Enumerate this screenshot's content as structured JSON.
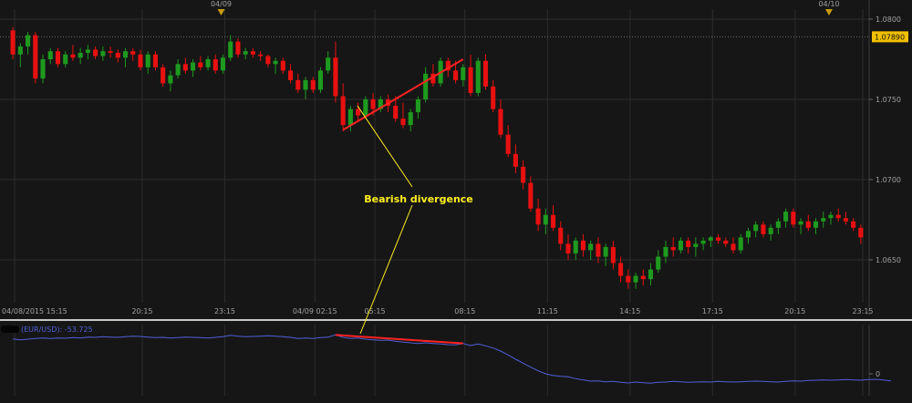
{
  "chart_data": [
    {
      "type": "candlestick",
      "symbol": "EUR/USD",
      "y_axis": {
        "ticks": [
          "1.0800",
          "1.0750",
          "1.0700",
          "1.0650"
        ],
        "range": [
          1.0615,
          1.0815
        ]
      },
      "x_axis": {
        "ticks": [
          "04/08/2015 15:15",
          "20:15",
          "23:15",
          "04/09 02:15",
          "05:15",
          "08:15",
          "11:15",
          "14:15",
          "17:15",
          "20:15",
          "23:15"
        ]
      },
      "date_markers": [
        "04/09",
        "04/10"
      ],
      "current_price": {
        "label": "1.07890",
        "value": 1.0789
      },
      "candles": [
        [
          1.0793,
          1.0795,
          1.0775,
          1.0778
        ],
        [
          1.0778,
          1.0785,
          1.077,
          1.0783
        ],
        [
          1.0783,
          1.0792,
          1.0778,
          1.079
        ],
        [
          1.079,
          1.0792,
          1.076,
          1.0763
        ],
        [
          1.0763,
          1.0778,
          1.076,
          1.0775
        ],
        [
          1.0775,
          1.0782,
          1.0772,
          1.078
        ],
        [
          1.078,
          1.0782,
          1.077,
          1.0772
        ],
        [
          1.0772,
          1.078,
          1.077,
          1.0778
        ],
        [
          1.0778,
          1.0784,
          1.0774,
          1.0776
        ],
        [
          1.0776,
          1.0782,
          1.0772,
          1.0779
        ],
        [
          1.0779,
          1.0784,
          1.0775,
          1.0781
        ],
        [
          1.0781,
          1.0783,
          1.0775,
          1.0777
        ],
        [
          1.0777,
          1.0783,
          1.0774,
          1.078
        ],
        [
          1.078,
          1.0783,
          1.0776,
          1.0779
        ],
        [
          1.0779,
          1.0781,
          1.0773,
          1.0776
        ],
        [
          1.0776,
          1.0782,
          1.077,
          1.078
        ],
        [
          1.078,
          1.0782,
          1.0774,
          1.0778
        ],
        [
          1.0778,
          1.0781,
          1.0768,
          1.077
        ],
        [
          1.077,
          1.078,
          1.0766,
          1.0778
        ],
        [
          1.0778,
          1.078,
          1.0768,
          1.077
        ],
        [
          1.077,
          1.0772,
          1.0758,
          1.076
        ],
        [
          1.076,
          1.0768,
          1.0755,
          1.0765
        ],
        [
          1.0765,
          1.0775,
          1.0763,
          1.0772
        ],
        [
          1.0772,
          1.0776,
          1.0766,
          1.0768
        ],
        [
          1.0768,
          1.0775,
          1.0764,
          1.0773
        ],
        [
          1.0773,
          1.0777,
          1.0768,
          1.077
        ],
        [
          1.077,
          1.0777,
          1.0768,
          1.0775
        ],
        [
          1.0775,
          1.0778,
          1.0766,
          1.0768
        ],
        [
          1.0768,
          1.0778,
          1.0766,
          1.0776
        ],
        [
          1.0776,
          1.079,
          1.0774,
          1.0786
        ],
        [
          1.0786,
          1.0788,
          1.0776,
          1.0778
        ],
        [
          1.0778,
          1.0782,
          1.0775,
          1.078
        ],
        [
          1.078,
          1.0782,
          1.0776,
          1.0778
        ],
        [
          1.0778,
          1.078,
          1.0774,
          1.0777
        ],
        [
          1.0777,
          1.0778,
          1.077,
          1.0772
        ],
        [
          1.0772,
          1.0776,
          1.0766,
          1.0774
        ],
        [
          1.0774,
          1.0776,
          1.0766,
          1.0768
        ],
        [
          1.0768,
          1.0772,
          1.076,
          1.0762
        ],
        [
          1.0762,
          1.0766,
          1.0754,
          1.0756
        ],
        [
          1.0756,
          1.0764,
          1.075,
          1.0762
        ],
        [
          1.0762,
          1.0764,
          1.0754,
          1.0756
        ],
        [
          1.0756,
          1.077,
          1.0754,
          1.0768
        ],
        [
          1.0768,
          1.078,
          1.0766,
          1.0776
        ],
        [
          1.0776,
          1.0786,
          1.0748,
          1.0752
        ],
        [
          1.0752,
          1.076,
          1.073,
          1.0734
        ],
        [
          1.0734,
          1.0746,
          1.073,
          1.0744
        ],
        [
          1.0744,
          1.0748,
          1.0736,
          1.074
        ],
        [
          1.074,
          1.0752,
          1.0738,
          1.075
        ],
        [
          1.075,
          1.0754,
          1.074,
          1.0744
        ],
        [
          1.0744,
          1.0752,
          1.0742,
          1.075
        ],
        [
          1.075,
          1.0753,
          1.0742,
          1.0746
        ],
        [
          1.0746,
          1.0752,
          1.0736,
          1.0738
        ],
        [
          1.0738,
          1.0748,
          1.0732,
          1.0734
        ],
        [
          1.0734,
          1.0744,
          1.073,
          1.0742
        ],
        [
          1.0742,
          1.0752,
          1.0738,
          1.075
        ],
        [
          1.075,
          1.077,
          1.0748,
          1.0766
        ],
        [
          1.0766,
          1.0772,
          1.0758,
          1.076
        ],
        [
          1.076,
          1.0776,
          1.0758,
          1.0774
        ],
        [
          1.0774,
          1.0776,
          1.0764,
          1.0768
        ],
        [
          1.0768,
          1.0774,
          1.076,
          1.0762
        ],
        [
          1.0762,
          1.0772,
          1.0758,
          1.077
        ],
        [
          1.077,
          1.0778,
          1.0752,
          1.0754
        ],
        [
          1.0754,
          1.0776,
          1.0752,
          1.0774
        ],
        [
          1.0774,
          1.0778,
          1.0756,
          1.0758
        ],
        [
          1.0758,
          1.0762,
          1.0742,
          1.0744
        ],
        [
          1.0744,
          1.075,
          1.0726,
          1.0728
        ],
        [
          1.0728,
          1.0734,
          1.0714,
          1.0716
        ],
        [
          1.0716,
          1.0722,
          1.0704,
          1.0708
        ],
        [
          1.0708,
          1.0712,
          1.0694,
          1.0698
        ],
        [
          1.0698,
          1.0702,
          1.068,
          1.0682
        ],
        [
          1.0682,
          1.0688,
          1.0668,
          1.0672
        ],
        [
          1.0672,
          1.0682,
          1.0666,
          1.0678
        ],
        [
          1.0678,
          1.0684,
          1.0668,
          1.067
        ],
        [
          1.067,
          1.0674,
          1.0656,
          1.066
        ],
        [
          1.066,
          1.0666,
          1.065,
          1.0654
        ],
        [
          1.0654,
          1.0664,
          1.065,
          1.0662
        ],
        [
          1.0662,
          1.0666,
          1.0652,
          1.0656
        ],
        [
          1.0656,
          1.0662,
          1.065,
          1.066
        ],
        [
          1.066,
          1.0664,
          1.0648,
          1.0652
        ],
        [
          1.0652,
          1.066,
          1.0646,
          1.0658
        ],
        [
          1.0658,
          1.0662,
          1.0644,
          1.0648
        ],
        [
          1.0648,
          1.0652,
          1.0636,
          1.064
        ],
        [
          1.064,
          1.0644,
          1.0632,
          1.0636
        ],
        [
          1.0636,
          1.0642,
          1.0632,
          1.064
        ],
        [
          1.064,
          1.0644,
          1.0634,
          1.0638
        ],
        [
          1.0638,
          1.0648,
          1.0634,
          1.0644
        ],
        [
          1.0644,
          1.0656,
          1.0642,
          1.0652
        ],
        [
          1.0652,
          1.0662,
          1.0648,
          1.0658
        ],
        [
          1.0658,
          1.0664,
          1.0652,
          1.0656
        ],
        [
          1.0656,
          1.0664,
          1.0654,
          1.0662
        ],
        [
          1.0662,
          1.0664,
          1.0654,
          1.0658
        ],
        [
          1.0658,
          1.0664,
          1.0652,
          1.066
        ],
        [
          1.066,
          1.0664,
          1.0656,
          1.0662
        ],
        [
          1.0662,
          1.0665,
          1.0658,
          1.0664
        ],
        [
          1.0664,
          1.0666,
          1.066,
          1.0662
        ],
        [
          1.0662,
          1.0664,
          1.0658,
          1.066
        ],
        [
          1.066,
          1.0664,
          1.0654,
          1.0656
        ],
        [
          1.0656,
          1.0666,
          1.0654,
          1.0664
        ],
        [
          1.0664,
          1.067,
          1.066,
          1.0668
        ],
        [
          1.0668,
          1.0674,
          1.0664,
          1.0672
        ],
        [
          1.0672,
          1.0674,
          1.0664,
          1.0666
        ],
        [
          1.0666,
          1.0672,
          1.0662,
          1.067
        ],
        [
          1.067,
          1.0676,
          1.0666,
          1.0674
        ],
        [
          1.0674,
          1.0682,
          1.067,
          1.068
        ],
        [
          1.068,
          1.0682,
          1.067,
          1.0672
        ],
        [
          1.0672,
          1.0676,
          1.0666,
          1.0674
        ],
        [
          1.0674,
          1.0678,
          1.0668,
          1.067
        ],
        [
          1.067,
          1.0676,
          1.0666,
          1.0674
        ],
        [
          1.0674,
          1.068,
          1.067,
          1.0676
        ],
        [
          1.0676,
          1.068,
          1.0672,
          1.0678
        ],
        [
          1.0678,
          1.0682,
          1.0674,
          1.0676
        ],
        [
          1.0676,
          1.068,
          1.0672,
          1.0674
        ],
        [
          1.0674,
          1.0676,
          1.0668,
          1.067
        ],
        [
          1.067,
          1.0672,
          1.066,
          1.0664
        ]
      ],
      "annotations": [
        {
          "type": "trendline",
          "color": "#ff2222",
          "from": [
            44,
            1.0731
          ],
          "to": [
            60,
            1.0775
          ]
        },
        {
          "type": "text",
          "text": "Bearish divergence",
          "color": "#ffee22"
        }
      ]
    },
    {
      "type": "line",
      "name": "(EUR/USD): -53.725",
      "y_axis": {
        "ticks": [
          "0"
        ]
      },
      "values": [
        115,
        112,
        114,
        116,
        118,
        116,
        118,
        117,
        119,
        118,
        121,
        120,
        122,
        121,
        120,
        122,
        124,
        123,
        121,
        119,
        120,
        118,
        119,
        121,
        120,
        119,
        118,
        120,
        122,
        127,
        124,
        122,
        123,
        124,
        125,
        124,
        122,
        120,
        116,
        118,
        116,
        119,
        121,
        128,
        120,
        116,
        118,
        114,
        112,
        110,
        111,
        107,
        104,
        102,
        100,
        102,
        100,
        98,
        96,
        95,
        100,
        93,
        98,
        92,
        85,
        75,
        62,
        48,
        35,
        22,
        10,
        0,
        -5,
        -8,
        -10,
        -16,
        -20,
        -24,
        -23,
        -26,
        -25,
        -28,
        -30,
        -27,
        -29,
        -31,
        -28,
        -27,
        -25,
        -26,
        -28,
        -27,
        -26,
        -27,
        -25,
        -26,
        -27,
        -26,
        -25,
        -24,
        -25,
        -26,
        -27,
        -25,
        -23,
        -24,
        -22,
        -21,
        -20,
        -21,
        -20,
        -19,
        -20,
        -21,
        -19,
        -18,
        -20,
        -23
      ],
      "ylim": [
        -60,
        150
      ],
      "annotations": [
        {
          "type": "trendline",
          "color": "#ff2222",
          "from": [
            43,
            128
          ],
          "to": [
            60,
            100
          ]
        }
      ]
    }
  ],
  "colors": {
    "background": "#161616",
    "grid": "#2c2c2c",
    "bull": "#1e9a1e",
    "bear": "#e81010",
    "indicator_line": "#5060d8",
    "axis_text": "#a0a0a0",
    "price_badge": "#f0c000",
    "callout_line": "#ffee22",
    "separator": "#c8c8c8"
  }
}
